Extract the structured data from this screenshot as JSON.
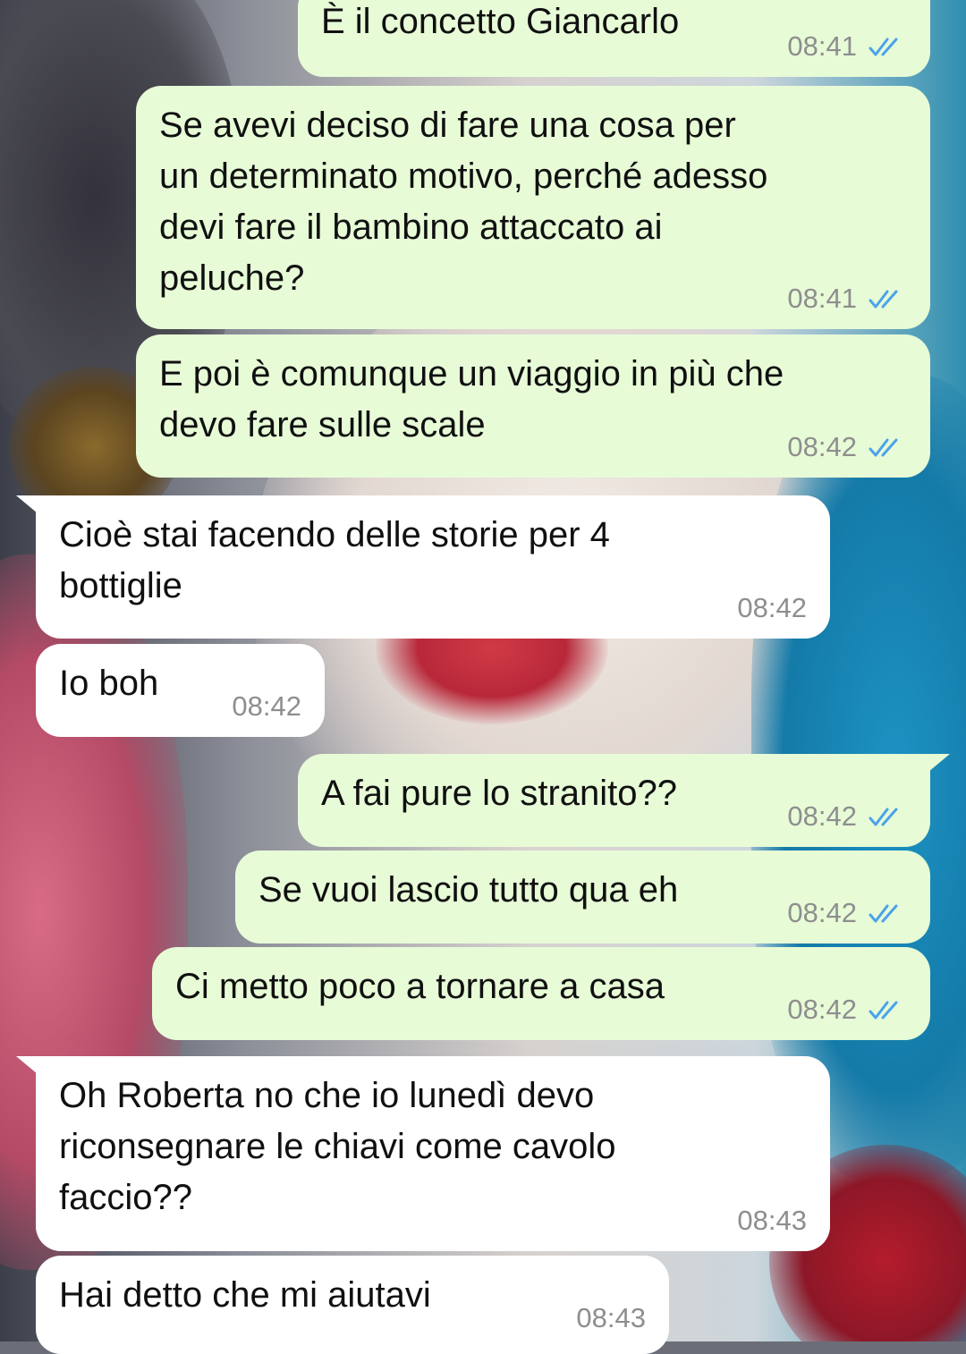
{
  "conversation": {
    "messages": [
      {
        "direction": "out",
        "text": "È il concetto Giancarlo",
        "time": "08:41",
        "status_icon": "double-check-read-icon"
      },
      {
        "direction": "out",
        "text": "Se avevi deciso di fare una cosa per\nun determinato motivo, perché adesso\ndevi fare il bambino attaccato ai\npeluche?",
        "time": "08:41",
        "status_icon": "double-check-read-icon"
      },
      {
        "direction": "out",
        "text": "E poi è comunque un viaggio in più che\ndevo fare sulle scale",
        "time": "08:42",
        "status_icon": "double-check-read-icon"
      },
      {
        "direction": "in",
        "text": "Cioè stai facendo delle storie per 4\nbottiglie",
        "time": "08:42"
      },
      {
        "direction": "in",
        "text": "Io boh",
        "time": "08:42"
      },
      {
        "direction": "out",
        "text": "A fai pure lo stranito??",
        "time": "08:42",
        "status_icon": "double-check-read-icon"
      },
      {
        "direction": "out",
        "text": "Se vuoi lascio tutto qua eh",
        "time": "08:42",
        "status_icon": "double-check-read-icon"
      },
      {
        "direction": "out",
        "text": "Ci metto poco a tornare a casa",
        "time": "08:42",
        "status_icon": "double-check-read-icon"
      },
      {
        "direction": "in",
        "text": "Oh Roberta no che io lunedì devo\nriconsegnare le chiavi come cavolo\nfaccio??",
        "time": "08:43"
      },
      {
        "direction": "in",
        "text": "Hai detto che mi aiutavi",
        "time": "08:43"
      }
    ]
  },
  "colors": {
    "outgoing_bubble": "#e7fbd7",
    "incoming_bubble": "#ffffff",
    "timestamp": "#8e8e8e",
    "read_ticks": "#4aa3ea"
  }
}
